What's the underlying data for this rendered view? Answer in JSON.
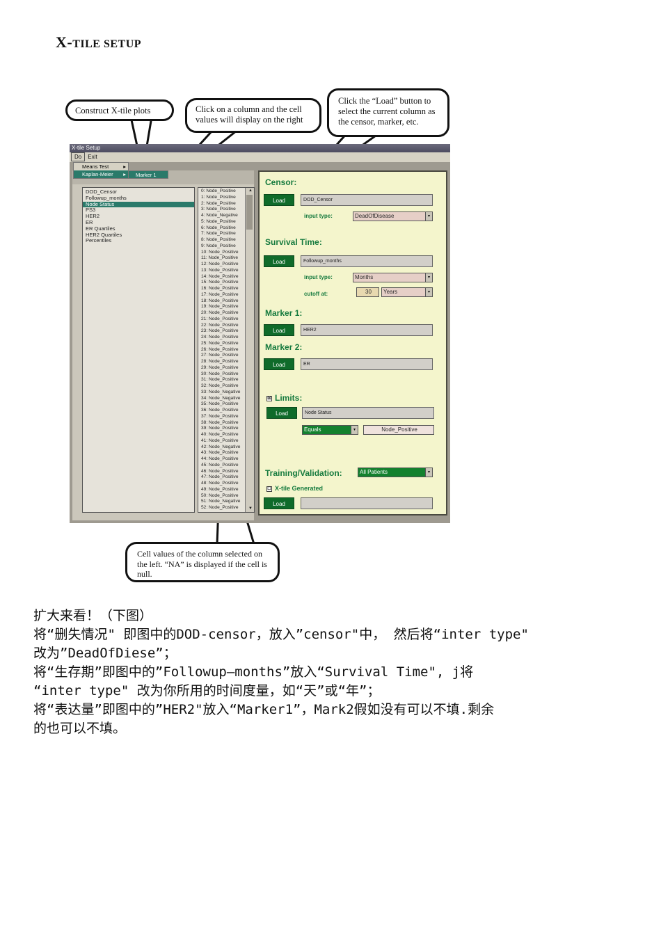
{
  "page_title_main": "X-",
  "page_title_rest": "TILE SETUP",
  "page_title_s": "S",
  "page_title_etup": "ETUP",
  "callouts": {
    "construct": "Construct X-tile plots",
    "click_column": "Click on a column and the cell values will display on the right",
    "click_load": "Click the “Load” button to select the current column as the censor, marker, etc.",
    "cell_values": "Cell values of the column selected on the left. “NA” is displayed if the cell is null."
  },
  "app": {
    "window_title": "X-tile Setup",
    "menu": {
      "do": "Do",
      "exit": "Exit"
    },
    "popup": {
      "means_test": "Means Test",
      "kaplan_meier": "Kaplan-Meier",
      "marker1": "Marker 1",
      "arrow": "▸"
    },
    "columns": [
      "DOD_Censor",
      "Followup_months",
      "Node Status",
      "PS3",
      "HER2",
      "ER",
      "ER Quartiles",
      "HER2 Quartiles",
      "Percentiles"
    ],
    "cell_values": [
      "0: Node_Positive",
      "1: Node_Positive",
      "2: Node_Positive",
      "3: Node_Positive",
      "4: Node_Negative",
      "5: Node_Positive",
      "6: Node_Positive",
      "7: Node_Positive",
      "8: Node_Positive",
      "9: Node_Positive",
      "10: Node_Positive",
      "11: Node_Positive",
      "12: Node_Positive",
      "13: Node_Positive",
      "14: Node_Positive",
      "15: Node_Positive",
      "16: Node_Positive",
      "17: Node_Positive",
      "18: Node_Positive",
      "19: Node_Positive",
      "20: Node_Positive",
      "21: Node_Positive",
      "22: Node_Positive",
      "23: Node_Positive",
      "24: Node_Positive",
      "25: Node_Positive",
      "26: Node_Positive",
      "27: Node_Positive",
      "28: Node_Positive",
      "29: Node_Positive",
      "30: Node_Positive",
      "31: Node_Positive",
      "32: Node_Positive",
      "33: Node_Negative",
      "34: Node_Negative",
      "35: Node_Positive",
      "36: Node_Positive",
      "37: Node_Positive",
      "38: Node_Positive",
      "39: Node_Positive",
      "40: Node_Positive",
      "41: Node_Positive",
      "42: Node_Negative",
      "43: Node_Positive",
      "44: Node_Positive",
      "45: Node_Positive",
      "46: Node_Positive",
      "47: Node_Positive",
      "48: Node_Positive",
      "49: Node_Positive",
      "50: Node_Positive",
      "51: Node_Negative",
      "52: Node_Positive"
    ],
    "scroll_up": "▲",
    "scroll_down": "▼",
    "censor": {
      "title": "Censor:",
      "load": "Load",
      "field": "DOD_Censor",
      "input_type_label": "input type:",
      "input_type": "DeadOfDisease"
    },
    "survival": {
      "title": "Survival Time:",
      "load": "Load",
      "field": "Followup_months",
      "input_type_label": "input type:",
      "input_type": "Months",
      "cutoff_label": "cutoff at:",
      "cutoff": "30",
      "cutoff_unit": "Years"
    },
    "marker1": {
      "title": "Marker 1:",
      "load": "Load",
      "field": "HER2"
    },
    "marker2": {
      "title": "Marker 2:",
      "load": "Load",
      "field": "ER"
    },
    "limits": {
      "check": "☒",
      "title": "Limits:",
      "load": "Load",
      "field": "Node Status",
      "operator": "Equals",
      "value": "Node_Positive"
    },
    "training": {
      "title": "Training/Validation:",
      "select": "All Patients",
      "xtile_check": "☐",
      "xtile_label": "X-tile Generated",
      "load": "Load",
      "field": ""
    },
    "dropdown_glyph": "▾"
  },
  "notes": [
    "扩大来看！（下图）",
    "将“删失情况\" 即图中的DOD-censor，放入”censor\"中， 然后将“inter type\"",
    "改为”DeadOfDiese”；",
    "将“生存期”即图中的”Followup—months”放入“Survival Time\", j将",
    "“inter type\" 改为你所用的时间度量，如“天”或“年”；",
    "将“表达量”即图中的”HER2\"放入“Marker1”，Mark2假如没有可以不填.剩余",
    "的也可以不填。"
  ]
}
